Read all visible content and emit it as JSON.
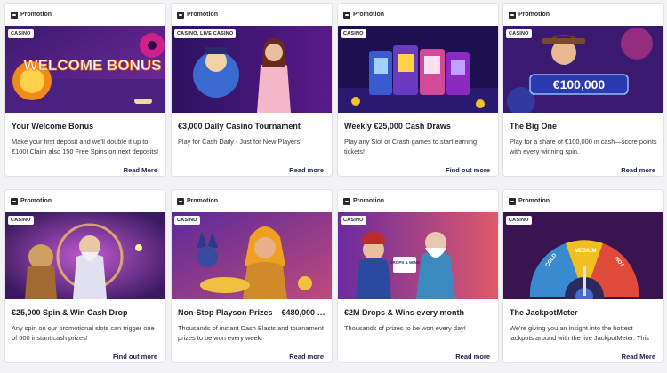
{
  "cards": [
    {
      "promo_label": "Promotion",
      "tag": "CASINO",
      "banner_text": "WELCOME BONUS",
      "title": "Your Welcome Bonus",
      "desc": "Make your first deposit and we'll double it up to €100! Claim also 150 Free Spins on next deposits!",
      "link": "Read More"
    },
    {
      "promo_label": "Promotion",
      "tag": "CASINO, LIVE CASINO",
      "title": "€3,000 Daily Casino Tournament",
      "desc": "Play for Cash Daily - Just for New Players!",
      "link": "Read more"
    },
    {
      "promo_label": "Promotion",
      "tag": "CASINO",
      "title": "Weekly €25,000 Cash Draws",
      "desc": "Play any Slot or Crash games to start earning tickets!",
      "link": "Find out more"
    },
    {
      "promo_label": "Promotion",
      "tag": "CASINO",
      "banner_text": "€100,000",
      "title": "The Big One",
      "desc": "Play for a share of €100,000 in cash—score points with every winning spin.",
      "link": "Read more"
    },
    {
      "promo_label": "Promotion",
      "tag": "CASINO",
      "title": "€25,000 Spin & Win Cash Drop",
      "desc": "Any spin on our promotional slots can trigger one of 500 instant cash prizes!",
      "link": "Find out more"
    },
    {
      "promo_label": "Promotion",
      "tag": "CASINO",
      "title": "Non-Stop Playson Prizes – €480,000 a m...",
      "desc": "Thousands of instant Cash Blasts and tournament prizes to be won every week.",
      "link": "Read more"
    },
    {
      "promo_label": "Promotion",
      "tag": "CASINO",
      "banner_text": "DROPS & WINS",
      "title": "€2M Drops & Wins every month",
      "desc": "Thousands of prizes to be won every day!",
      "link": "Read more"
    },
    {
      "promo_label": "Promotion",
      "tag": "CASINO",
      "banner_text": [
        "COLD",
        "MEDIUM",
        "HOT"
      ],
      "title": "The JackpotMeter",
      "desc": "We're giving you an insight into the hottest jackpots around with the live JackpotMeter. This way, you'll",
      "link": "Read More"
    }
  ],
  "colors": {
    "link": "#23264a",
    "card_bg": "#ffffff",
    "page_bg": "#f3f3f5"
  }
}
